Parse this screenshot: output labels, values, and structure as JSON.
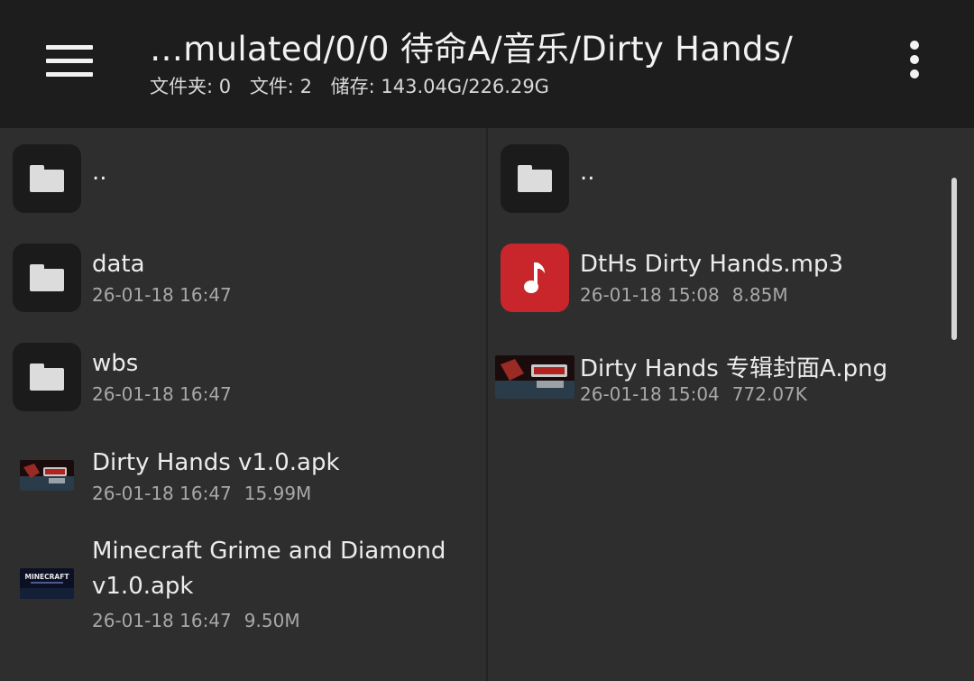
{
  "header": {
    "path": "…mulated/0/0 待命A/音乐/Dirty Hands/",
    "folders_label": "文件夹: 0",
    "files_label": "文件: 2",
    "storage_label": "储存: 143.04G/226.29G"
  },
  "left_pane": {
    "items": [
      {
        "name": "..",
        "date": "",
        "size": "",
        "icon": "folder-icon"
      },
      {
        "name": "data",
        "date": "26-01-18 16:47",
        "size": "",
        "icon": "folder-icon"
      },
      {
        "name": "wbs",
        "date": "26-01-18 16:47",
        "size": "",
        "icon": "folder-icon"
      },
      {
        "name": "Dirty Hands v1.0.apk",
        "date": "26-01-18 16:47",
        "size": "15.99M",
        "icon": "apk-thumbnail"
      },
      {
        "name_line1": "Minecraft Grime and Diamond",
        "name_line2": "v1.0.apk",
        "date": "26-01-18 16:47",
        "size": "9.50M",
        "icon": "apk-thumbnail",
        "thumb_text": "MINECRAFT"
      }
    ]
  },
  "right_pane": {
    "items": [
      {
        "name": "..",
        "date": "",
        "size": "",
        "icon": "folder-icon"
      },
      {
        "name": "DtHs Dirty Hands.mp3",
        "date": "26-01-18 15:08",
        "size": "8.85M",
        "icon": "music-note-icon"
      },
      {
        "name": "Dirty Hands 专辑封面A.png",
        "date": "26-01-18 15:04",
        "size": "772.07K",
        "icon": "image-thumbnail"
      }
    ]
  },
  "colors": {
    "appbar": "#1d1d1d",
    "background": "#2e2e2e",
    "music_icon": "#c8262b"
  }
}
